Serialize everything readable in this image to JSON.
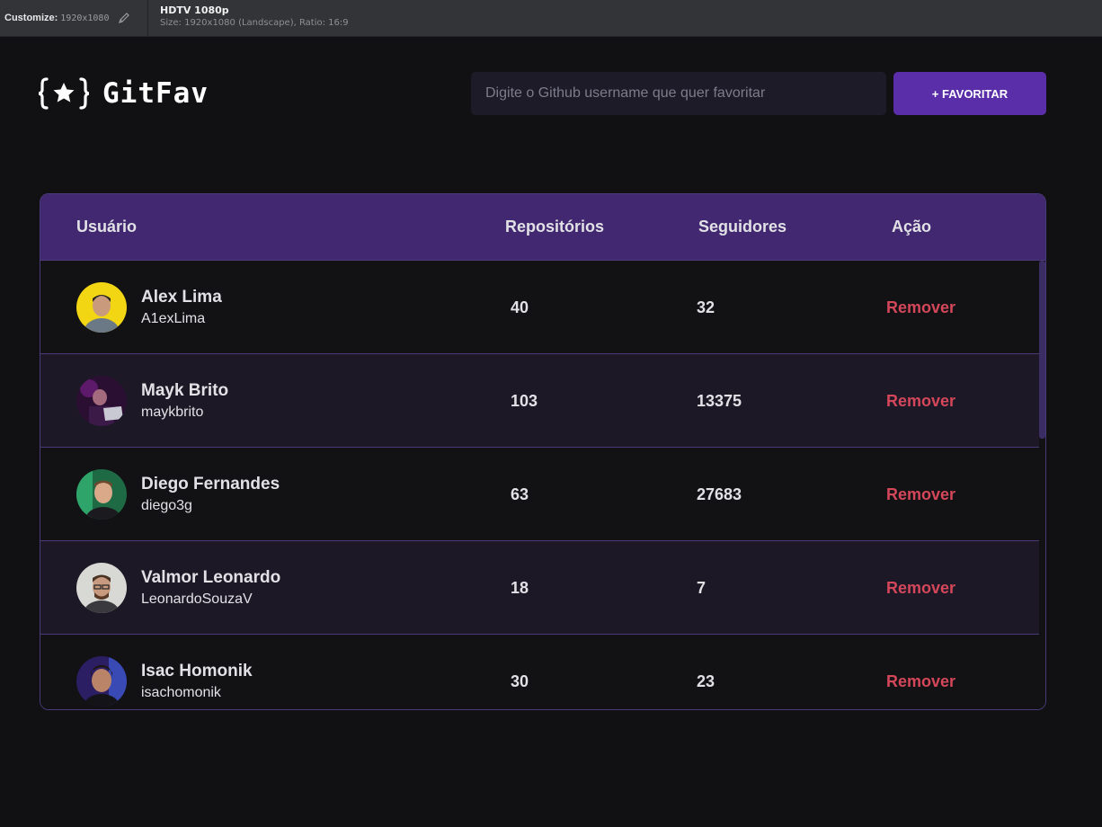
{
  "toolbar": {
    "customize_label": "Customize:",
    "customize_value": "1920x1080",
    "preset_title": "HDTV 1080p",
    "preset_details": "Size: 1920x1080 (Landscape), Ratio: 16:9"
  },
  "app": {
    "name": "GitFav",
    "search_placeholder": "Digite o Github username que quer favoritar",
    "search_value": "",
    "favorite_button": "+ FAVORITAR",
    "accent_color": "#5a2ea8",
    "remove_color": "#d4475b"
  },
  "table": {
    "headers": {
      "user": "Usuário",
      "repos": "Repositórios",
      "followers": "Seguidores",
      "action": "Ação"
    },
    "rows": [
      {
        "name": "Alex Lima",
        "login": "A1exLima",
        "repos": "40",
        "followers": "32",
        "action": "Remover"
      },
      {
        "name": "Mayk Brito",
        "login": "maykbrito",
        "repos": "103",
        "followers": "13375",
        "action": "Remover"
      },
      {
        "name": "Diego Fernandes",
        "login": "diego3g",
        "repos": "63",
        "followers": "27683",
        "action": "Remover"
      },
      {
        "name": "Valmor Leonardo",
        "login": "LeonardoSouzaV",
        "repos": "18",
        "followers": "7",
        "action": "Remover"
      },
      {
        "name": "Isac Homonik",
        "login": "isachomonik",
        "repos": "30",
        "followers": "23",
        "action": "Remover"
      }
    ]
  }
}
